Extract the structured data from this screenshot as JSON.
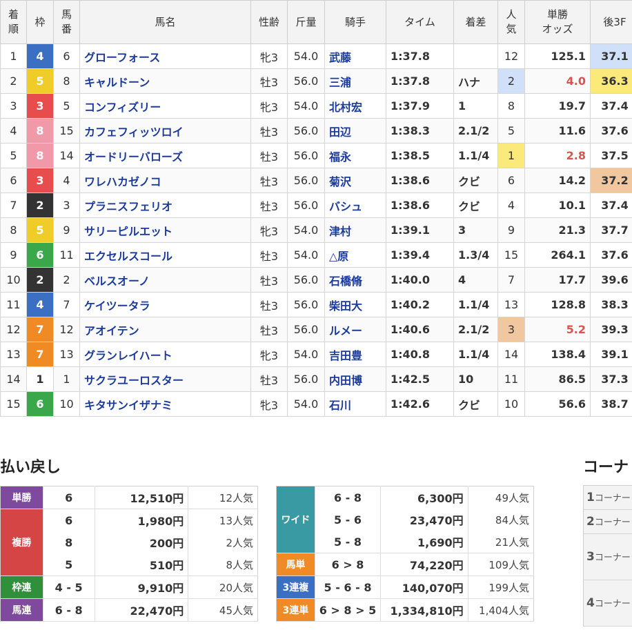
{
  "results": {
    "headers": {
      "rank": [
        "着",
        "順"
      ],
      "waku": "枠",
      "umaban": [
        "馬",
        "番"
      ],
      "name": "馬名",
      "sexage": "性齢",
      "weight": "斤量",
      "jockey": "騎手",
      "time": "タイム",
      "margin": "着差",
      "pop": [
        "人",
        "気"
      ],
      "odds": [
        "単勝",
        "オッズ"
      ],
      "last3f": "後3F"
    },
    "rows": [
      {
        "rank": "1",
        "waku": "4",
        "umaban": "6",
        "name": "グローフォース",
        "sexage": "牝3",
        "weight": "54.0",
        "jockey": "武藤",
        "time": "1:37.8",
        "margin": "",
        "pop": "12",
        "odds": "125.1",
        "last3f": "37.1"
      },
      {
        "rank": "2",
        "waku": "5",
        "umaban": "8",
        "name": "キャルドーン",
        "sexage": "牡3",
        "weight": "56.0",
        "jockey": "三浦",
        "time": "1:37.8",
        "margin": "ハナ",
        "pop": "2",
        "odds": "4.0",
        "last3f": "36.3"
      },
      {
        "rank": "3",
        "waku": "3",
        "umaban": "5",
        "name": "コンフィズリー",
        "sexage": "牝3",
        "weight": "54.0",
        "jockey": "北村宏",
        "time": "1:37.9",
        "margin": "1",
        "pop": "8",
        "odds": "19.7",
        "last3f": "37.4"
      },
      {
        "rank": "4",
        "waku": "8",
        "umaban": "15",
        "name": "カフェフィッツロイ",
        "sexage": "牡3",
        "weight": "56.0",
        "jockey": "田辺",
        "time": "1:38.3",
        "margin": "2.1/2",
        "pop": "5",
        "odds": "11.6",
        "last3f": "37.6"
      },
      {
        "rank": "5",
        "waku": "8",
        "umaban": "14",
        "name": "オードリーバローズ",
        "sexage": "牡3",
        "weight": "56.0",
        "jockey": "福永",
        "time": "1:38.5",
        "margin": "1.1/4",
        "pop": "1",
        "odds": "2.8",
        "last3f": "37.5"
      },
      {
        "rank": "6",
        "waku": "3",
        "umaban": "4",
        "name": "ワレハカゼノコ",
        "sexage": "牡3",
        "weight": "56.0",
        "jockey": "菊沢",
        "time": "1:38.6",
        "margin": "クビ",
        "pop": "6",
        "odds": "14.2",
        "last3f": "37.2"
      },
      {
        "rank": "7",
        "waku": "2",
        "umaban": "3",
        "name": "プラニスフェリオ",
        "sexage": "牡3",
        "weight": "56.0",
        "jockey": "バシュ",
        "time": "1:38.6",
        "margin": "クビ",
        "pop": "4",
        "odds": "10.1",
        "last3f": "37.4"
      },
      {
        "rank": "8",
        "waku": "5",
        "umaban": "9",
        "name": "サリーピルエット",
        "sexage": "牝3",
        "weight": "54.0",
        "jockey": "津村",
        "time": "1:39.1",
        "margin": "3",
        "pop": "9",
        "odds": "21.3",
        "last3f": "37.7"
      },
      {
        "rank": "9",
        "waku": "6",
        "umaban": "11",
        "name": "エクセルスコール",
        "sexage": "牡3",
        "weight": "54.0",
        "jockey": "△原",
        "time": "1:39.4",
        "margin": "1.3/4",
        "pop": "15",
        "odds": "264.1",
        "last3f": "37.6"
      },
      {
        "rank": "10",
        "waku": "2",
        "umaban": "2",
        "name": "ベルスオーノ",
        "sexage": "牡3",
        "weight": "56.0",
        "jockey": "石橋脩",
        "time": "1:40.0",
        "margin": "4",
        "pop": "7",
        "odds": "17.7",
        "last3f": "39.6"
      },
      {
        "rank": "11",
        "waku": "4",
        "umaban": "7",
        "name": "ケイツータラ",
        "sexage": "牡3",
        "weight": "56.0",
        "jockey": "柴田大",
        "time": "1:40.2",
        "margin": "1.1/4",
        "pop": "13",
        "odds": "128.8",
        "last3f": "38.3"
      },
      {
        "rank": "12",
        "waku": "7",
        "umaban": "12",
        "name": "アオイテン",
        "sexage": "牡3",
        "weight": "56.0",
        "jockey": "ルメー",
        "time": "1:40.6",
        "margin": "2.1/2",
        "pop": "3",
        "odds": "5.2",
        "last3f": "39.3"
      },
      {
        "rank": "13",
        "waku": "7",
        "umaban": "13",
        "name": "グランレイハート",
        "sexage": "牝3",
        "weight": "54.0",
        "jockey": "吉田豊",
        "time": "1:40.8",
        "margin": "1.1/4",
        "pop": "14",
        "odds": "138.4",
        "last3f": "39.1"
      },
      {
        "rank": "14",
        "waku": "1",
        "umaban": "1",
        "name": "サクラユーロスター",
        "sexage": "牡3",
        "weight": "56.0",
        "jockey": "内田博",
        "time": "1:42.5",
        "margin": "10",
        "pop": "11",
        "odds": "86.5",
        "last3f": "37.3"
      },
      {
        "rank": "15",
        "waku": "6",
        "umaban": "10",
        "name": "キタサンイザナミ",
        "sexage": "牝3",
        "weight": "54.0",
        "jockey": "石川",
        "time": "1:42.6",
        "margin": "クビ",
        "pop": "10",
        "odds": "56.6",
        "last3f": "38.7"
      }
    ]
  },
  "payout_title": "払い戻し",
  "corner_title": "コーナー",
  "payout_left": {
    "tansho": {
      "label": "単勝",
      "combo": "6",
      "amount": "12,510円",
      "pop": "12人気"
    },
    "fukusho": {
      "label": "複勝",
      "rows": [
        {
          "combo": "6",
          "amount": "1,980円",
          "pop": "13人気"
        },
        {
          "combo": "8",
          "amount": "200円",
          "pop": "2人気"
        },
        {
          "combo": "5",
          "amount": "510円",
          "pop": "8人気"
        }
      ]
    },
    "wakuren": {
      "label": "枠連",
      "combo": "4 - 5",
      "amount": "9,910円",
      "pop": "20人気"
    },
    "umaren": {
      "label": "馬連",
      "combo": "6 - 8",
      "amount": "22,470円",
      "pop": "45人気"
    }
  },
  "payout_right": {
    "wide": {
      "label": "ワイド",
      "rows": [
        {
          "combo": "6 - 8",
          "amount": "6,300円",
          "pop": "49人気"
        },
        {
          "combo": "5 - 6",
          "amount": "23,470円",
          "pop": "84人気"
        },
        {
          "combo": "5 - 8",
          "amount": "1,690円",
          "pop": "21人気"
        }
      ]
    },
    "umatan": {
      "label": "馬単",
      "combo": "6 > 8",
      "amount": "74,220円",
      "pop": "109人気"
    },
    "sanrenpuku": {
      "label": "3連複",
      "combo": "5 - 6 - 8",
      "amount": "140,070円",
      "pop": "199人気"
    },
    "sanrentan": {
      "label": "3連単",
      "combo": "6 > 8 > 5",
      "amount": "1,334,810円",
      "pop": "1,404人気"
    }
  },
  "corner": [
    {
      "num": "1",
      "label": "コーナー"
    },
    {
      "num": "2",
      "label": "コーナー"
    },
    {
      "num": "3",
      "label": "コーナー"
    },
    {
      "num": "4",
      "label": "コーナー"
    }
  ],
  "colors": {
    "waku1": "#ffffff",
    "waku2": "#333333",
    "waku3": "#e84d4d",
    "waku4": "#3b6fc4",
    "waku5": "#f0cc28",
    "waku6": "#3aa84a",
    "waku7": "#f08a24",
    "waku8": "#f199a8",
    "pop1_bg": "#fbe97a",
    "pop2_bg": "#cfe0f8",
    "pop3_bg": "#f1c7a0",
    "link": "#1a3a9c",
    "odds_favorite": "#d9534f"
  }
}
